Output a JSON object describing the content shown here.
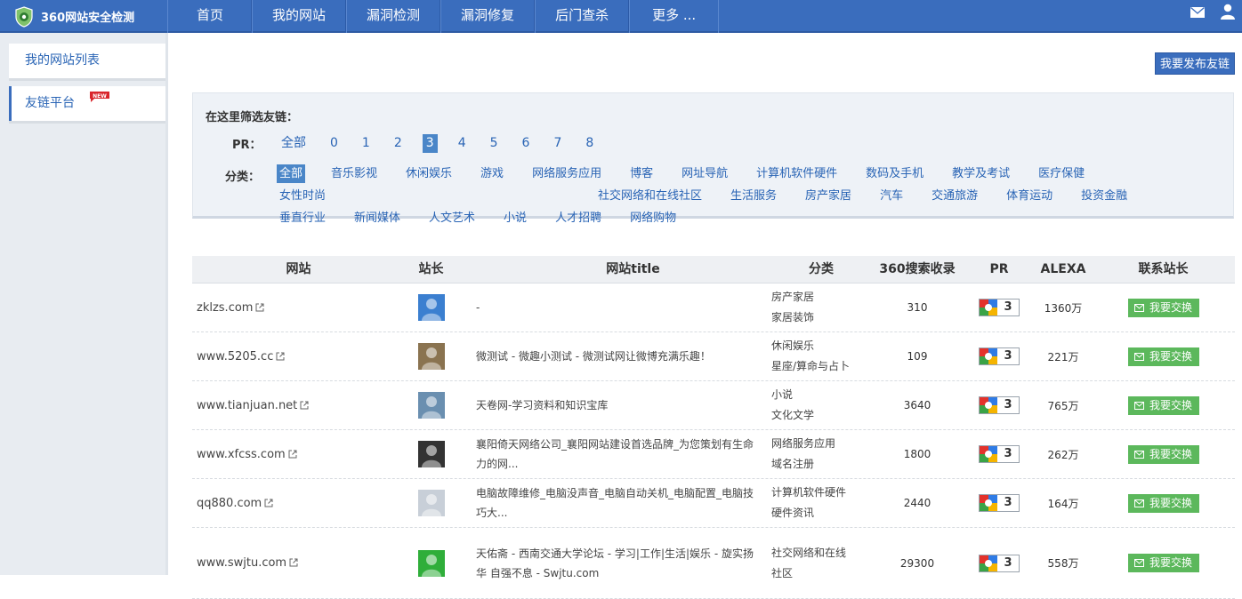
{
  "brand": {
    "name": "360网站安全检测"
  },
  "nav": {
    "items": [
      "首页",
      "我的网站",
      "漏洞检测",
      "漏洞修复",
      "后门查杀",
      "更多 ..."
    ]
  },
  "sidebar": {
    "items": [
      "我的网站列表",
      "友链平台"
    ]
  },
  "publish_label": "我要发布友链",
  "filter": {
    "title": "在这里筛选友链：",
    "pr_label": "PR：",
    "pr_options": [
      "全部",
      "0",
      "1",
      "2",
      "3",
      "4",
      "5",
      "6",
      "7",
      "8"
    ],
    "pr_selected": "3",
    "cat_label": "分类：",
    "categories": [
      "全部",
      "音乐影视",
      "休闲娱乐",
      "游戏",
      "网络服务应用",
      "博客",
      "网址导航",
      "计算机软件硬件",
      "数码及手机",
      "教学及考试",
      "医疗保健",
      "女性时尚",
      "社交网络和在线社区",
      "生活服务",
      "房产家居",
      "汽车",
      "交通旅游",
      "体育运动",
      "投资金融",
      "垂直行业",
      "新闻媒体",
      "人文艺术",
      "小说",
      "人才招聘",
      "网络购物"
    ],
    "cat_selected": "全部"
  },
  "table": {
    "headers": [
      "网站",
      "站长",
      "网站title",
      "分类",
      "360搜索收录",
      "PR",
      "ALEXA",
      "联系站长"
    ],
    "swap_label": "我要交换",
    "rows": [
      {
        "site": "zklzs.com",
        "title": "-",
        "cat1": "房产家居",
        "cat2": "家居装饰",
        "index": "310",
        "pr": "3",
        "alexa": "1360万",
        "avatar": "#3b7fd0"
      },
      {
        "site": "www.5205.cc",
        "title": "微测试 - 微趣小测试 - 微测试网让微博充满乐趣！",
        "cat1": "休闲娱乐",
        "cat2": "星座/算命与占卜",
        "index": "109",
        "pr": "3",
        "alexa": "221万",
        "avatar": "#8a7350"
      },
      {
        "site": "www.tianjuan.net",
        "title": "天卷网-学习资料和知识宝库",
        "cat1": "小说",
        "cat2": "文化文学",
        "index": "3640",
        "pr": "3",
        "alexa": "765万",
        "avatar": "#6a8fb0"
      },
      {
        "site": "www.xfcss.com",
        "title": "襄阳倚天网络公司_襄阳网站建设首选品牌_为您策划有生命力的网...",
        "cat1": "网络服务应用",
        "cat2": "域名注册",
        "index": "1800",
        "pr": "3",
        "alexa": "262万",
        "avatar": "#333333"
      },
      {
        "site": "qq880.com",
        "title": "电脑故障维修_电脑没声音_电脑自动关机_电脑配置_电脑技巧大...",
        "cat1": "计算机软件硬件",
        "cat2": "硬件资讯",
        "index": "2440",
        "pr": "3",
        "alexa": "164万",
        "avatar": "#c8cfd8"
      },
      {
        "site": "www.swjtu.com",
        "title": "天佑斋 - 西南交通大学论坛 - 学习|工作|生活|娱乐 - 旋实扬华 自强不息 - Swjtu.com",
        "cat1": "社交网络和在线",
        "cat2": "社区",
        "index": "29300",
        "pr": "3",
        "alexa": "558万",
        "avatar": "#2fae3a"
      }
    ]
  }
}
